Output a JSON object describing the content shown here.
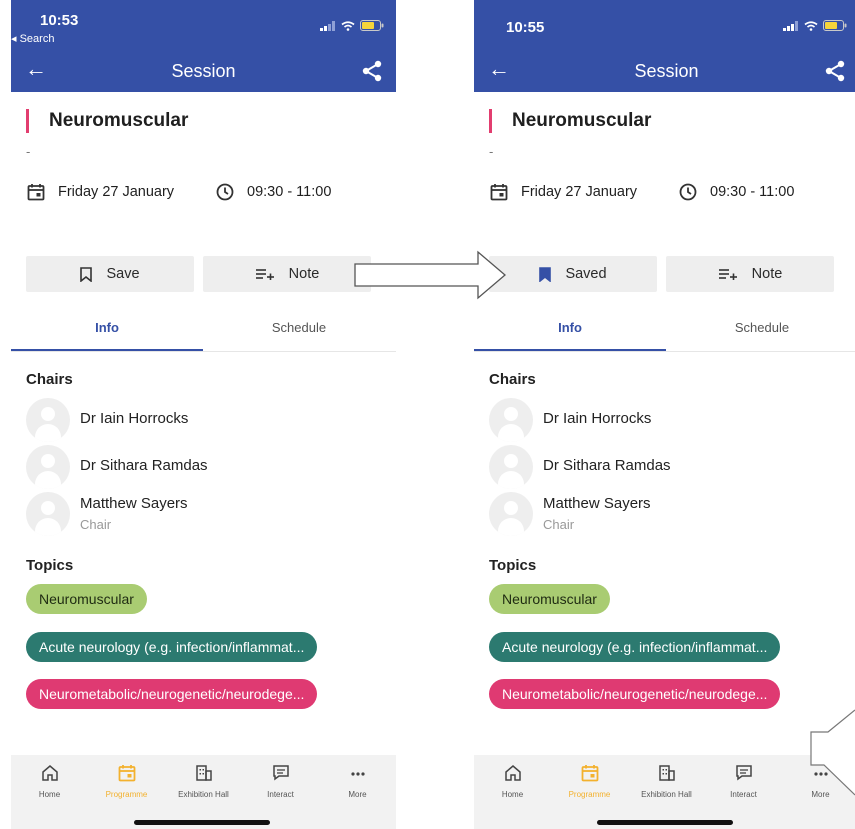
{
  "screens": [
    {
      "status": {
        "time": "10:53",
        "back_search": "◂ Search"
      },
      "appbar": {
        "title": "Session"
      },
      "session": {
        "title": "Neuromuscular",
        "dash": "-",
        "date": "Friday 27 January",
        "time": "09:30 - 11:00"
      },
      "actions": {
        "save_label": "Save",
        "save_state": "unsaved",
        "note_label": "Note"
      },
      "tabs": {
        "info": "Info",
        "schedule": "Schedule",
        "active": "info"
      },
      "chairs": {
        "heading": "Chairs",
        "people": [
          {
            "name": "Dr Iain Horrocks"
          },
          {
            "name": "Dr Sithara Ramdas"
          },
          {
            "name": "Matthew Sayers",
            "role": "Chair"
          }
        ]
      },
      "topics": {
        "heading": "Topics",
        "chips": [
          {
            "label": "Neuromuscular",
            "color": "#a9cc72"
          },
          {
            "label": "Acute neurology (e.g. infection/inflammat...",
            "color": "#2c7a70"
          },
          {
            "label": "Neurometabolic/neurogenetic/neurodege...",
            "color": "#df3a72"
          }
        ]
      },
      "nav": {
        "items": [
          {
            "label": "Home",
            "icon": "home-icon"
          },
          {
            "label": "Programme",
            "icon": "calendar-icon",
            "active": true
          },
          {
            "label": "Exhibition Hall",
            "icon": "building-icon"
          },
          {
            "label": "Interact",
            "icon": "chat-icon"
          },
          {
            "label": "More",
            "icon": "more-icon"
          }
        ]
      }
    },
    {
      "status": {
        "time": "10:55",
        "back_search": ""
      },
      "appbar": {
        "title": "Session"
      },
      "session": {
        "title": "Neuromuscular",
        "dash": "-",
        "date": "Friday 27 January",
        "time": "09:30 - 11:00"
      },
      "actions": {
        "save_label": "Saved",
        "save_state": "saved",
        "note_label": "Note"
      },
      "tabs": {
        "info": "Info",
        "schedule": "Schedule",
        "active": "info"
      },
      "chairs": {
        "heading": "Chairs",
        "people": [
          {
            "name": "Dr Iain Horrocks"
          },
          {
            "name": "Dr Sithara Ramdas"
          },
          {
            "name": "Matthew Sayers",
            "role": "Chair"
          }
        ]
      },
      "topics": {
        "heading": "Topics",
        "chips": [
          {
            "label": "Neuromuscular",
            "color": "#a9cc72"
          },
          {
            "label": "Acute neurology (e.g. infection/inflammat...",
            "color": "#2c7a70"
          },
          {
            "label": "Neurometabolic/neurogenetic/neurodege...",
            "color": "#df3a72"
          }
        ]
      },
      "nav": {
        "items": [
          {
            "label": "Home",
            "icon": "home-icon"
          },
          {
            "label": "Programme",
            "icon": "calendar-icon",
            "active": true
          },
          {
            "label": "Exhibition Hall",
            "icon": "building-icon"
          },
          {
            "label": "Interact",
            "icon": "chat-icon"
          },
          {
            "label": "More",
            "icon": "more-icon"
          }
        ]
      }
    }
  ],
  "colors": {
    "appbar": "#3550a6",
    "accent_active": "#f3b12e",
    "title_bar": "#e23d6f"
  }
}
